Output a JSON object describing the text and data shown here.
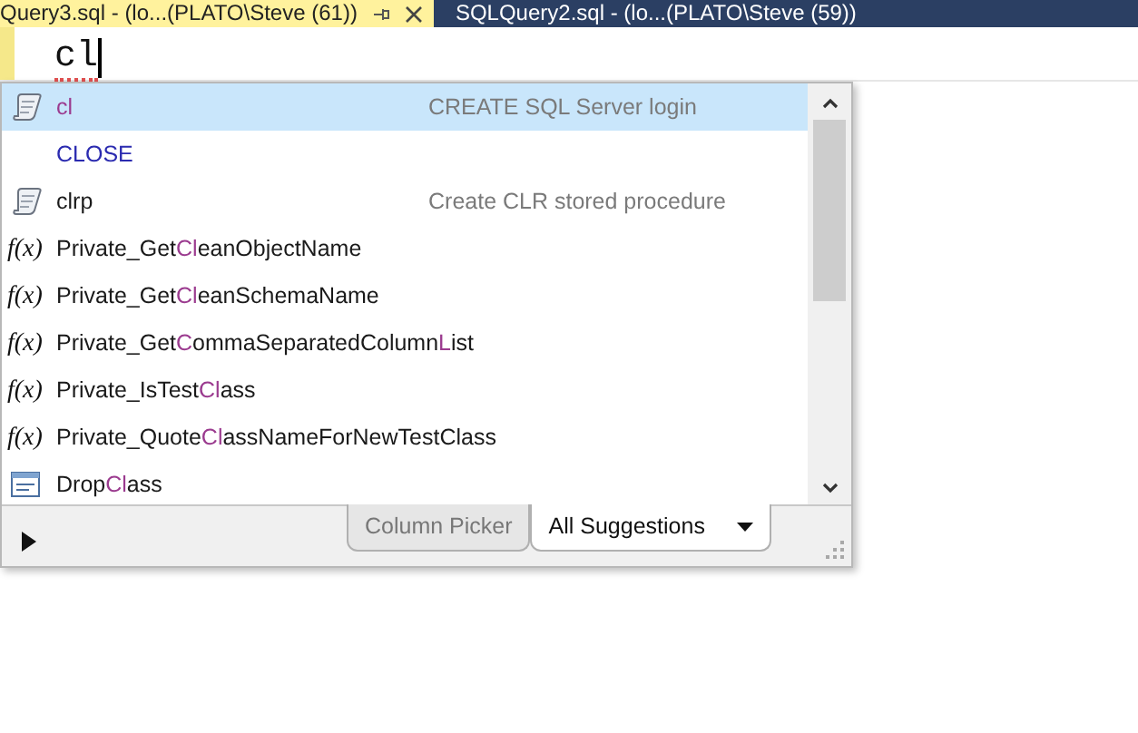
{
  "tabs": [
    {
      "label": "Query3.sql - (lo...(PLATO\\Steve (61))",
      "selected": true
    },
    {
      "label": "SQLQuery2.sql - (lo...(PLATO\\Steve (59))",
      "selected": false
    }
  ],
  "editor": {
    "typed_text": "cl"
  },
  "completion": {
    "items": [
      {
        "kind": "snippet",
        "parts": [
          {
            "text": "cl",
            "match": true
          }
        ],
        "description": "CREATE SQL Server login",
        "selected": true
      },
      {
        "kind": "keyword",
        "parts": [
          {
            "text": "CLOSE",
            "match": false
          }
        ],
        "selected": false
      },
      {
        "kind": "snippet",
        "parts": [
          {
            "text": "clrp",
            "match": false
          }
        ],
        "description": "Create CLR stored procedure",
        "selected": false
      },
      {
        "kind": "function",
        "icon_label": "f(x)",
        "parts": [
          {
            "text": "Private_Get",
            "match": false
          },
          {
            "text": "Cl",
            "match": true
          },
          {
            "text": "eanObjectName",
            "match": false
          }
        ],
        "selected": false
      },
      {
        "kind": "function",
        "icon_label": "f(x)",
        "parts": [
          {
            "text": "Private_Get",
            "match": false
          },
          {
            "text": "Cl",
            "match": true
          },
          {
            "text": "eanSchemaName",
            "match": false
          }
        ],
        "selected": false
      },
      {
        "kind": "function",
        "icon_label": "f(x)",
        "parts": [
          {
            "text": "Private_Get",
            "match": false
          },
          {
            "text": "C",
            "match": true
          },
          {
            "text": "ommaSeparatedColumn",
            "match": false
          },
          {
            "text": "L",
            "match": true
          },
          {
            "text": "ist",
            "match": false
          }
        ],
        "selected": false
      },
      {
        "kind": "function",
        "icon_label": "f(x)",
        "parts": [
          {
            "text": "Private_IsTest",
            "match": false
          },
          {
            "text": "Cl",
            "match": true
          },
          {
            "text": "ass",
            "match": false
          }
        ],
        "selected": false
      },
      {
        "kind": "function",
        "icon_label": "f(x)",
        "parts": [
          {
            "text": "Private_Quote",
            "match": false
          },
          {
            "text": "Cl",
            "match": true
          },
          {
            "text": "assNameForNewTestClass",
            "match": false
          }
        ],
        "selected": false
      },
      {
        "kind": "table",
        "parts": [
          {
            "text": "Drop",
            "match": false
          },
          {
            "text": "Cl",
            "match": true
          },
          {
            "text": "ass",
            "match": false
          }
        ],
        "selected": false
      }
    ],
    "mode_tabs": [
      {
        "label": "Column Picker",
        "selected": false
      },
      {
        "label": "All Suggestions",
        "selected": true,
        "dropdown": true
      }
    ]
  }
}
